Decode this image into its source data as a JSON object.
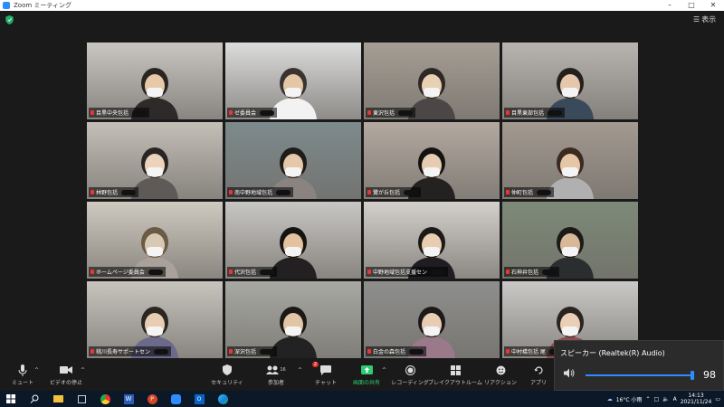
{
  "window": {
    "title": "Zoom ミーティング"
  },
  "header": {
    "view_label": "表示"
  },
  "participants": [
    {
      "name": "目黒中央包括",
      "bg": "#c9c6c2",
      "skin": "#e7c9a8",
      "hair": "#2a2523",
      "shirt": "#2f2a2a"
    },
    {
      "name": "ゼ委員会",
      "bg": "#dcdcdc",
      "skin": "#e5c7a5",
      "hair": "#3a3431",
      "shirt": "#f2f2f2"
    },
    {
      "name": "東沢包括",
      "bg": "#a59e94",
      "skin": "#e8d0b3",
      "hair": "#2e2826",
      "shirt": "#4a4746"
    },
    {
      "name": "目黒東部包括",
      "bg": "#b8b4b0",
      "skin": "#e5c7ac",
      "hair": "#24201d",
      "shirt": "#3a4a5a"
    },
    {
      "name": "林野包括",
      "bg": "#c4c0b8",
      "skin": "#ecd4bc",
      "hair": "#2a2525",
      "shirt": "#5d5a58"
    },
    {
      "name": "南中野地域包括",
      "bg": "#7d8a8c",
      "skin": "#e5c8aa",
      "hair": "#1e1b19",
      "shirt": "#8a8380"
    },
    {
      "name": "鷺が丘包括",
      "bg": "#b3a9a0",
      "skin": "#e6cdb2",
      "hair": "#141312",
      "shirt": "#242121"
    },
    {
      "name": "仲町包括",
      "bg": "#a39a91",
      "skin": "#e5c7a6",
      "hair": "#3a2a20",
      "shirt": "#b0b0b0"
    },
    {
      "name": "ホームページ委員会",
      "bg": "#cfcac0",
      "skin": "#d8c9b4",
      "hair": "#6b5a44",
      "shirt": "#aaa29a"
    },
    {
      "name": "代沢包括",
      "bg": "#c8c6c3",
      "skin": "#e3c29f",
      "hair": "#151413",
      "shirt": "#222021"
    },
    {
      "name": "中野地域包括支援セン",
      "bg": "#d3d0cc",
      "skin": "#e8cdb0",
      "hair": "#1c1918",
      "shirt": "#1e1e22"
    },
    {
      "name": "石神井包括",
      "bg": "#7d8a78",
      "skin": "#d8b899",
      "hair": "#1c1a18",
      "shirt": "#2b2e31"
    },
    {
      "name": "桃川長寿サポートセン",
      "bg": "#c7c3bd",
      "skin": "#e7cdb3",
      "hair": "#2c2622",
      "shirt": "#6b6a8a"
    },
    {
      "name": "深沢包括",
      "bg": "#a8a9a3",
      "skin": "#e2c4a6",
      "hair": "#1b1816",
      "shirt": "#222"
    },
    {
      "name": "白金の森包括",
      "bg": "#8e8f8d",
      "skin": "#e8cdb4",
      "hair": "#1d1918",
      "shirt": "#9a7a8a"
    },
    {
      "name": "中村橋包括 尾",
      "bg": "#cac9c7",
      "skin": "#e8cfb6",
      "hair": "#2a2321",
      "shirt": "#8b4e4e"
    }
  ],
  "toolbar": {
    "mute": "ミュート",
    "video": "ビデオの停止",
    "security": "セキュリティ",
    "participants": "参加者",
    "participants_count": "16",
    "chat": "チャット",
    "chat_badge": "2",
    "share": "画面の共有",
    "record": "レコーディング",
    "breakout": "ブレイクアウトルーム",
    "reactions": "リアクション",
    "apps": "アプリ"
  },
  "speaker_panel": {
    "title": "スピーカー (Realtek(R) Audio)",
    "volume": 98,
    "volume_label": "98"
  },
  "taskbar": {
    "weather": "16°C 小雨",
    "ime": "A",
    "time": "14:13",
    "date": "2021/11/24"
  },
  "colors": {
    "accent": "#2d8cff",
    "active_speaker_border": "#c6d95a",
    "share_green": "#2ecc71",
    "badge_red": "#e02f2f"
  }
}
